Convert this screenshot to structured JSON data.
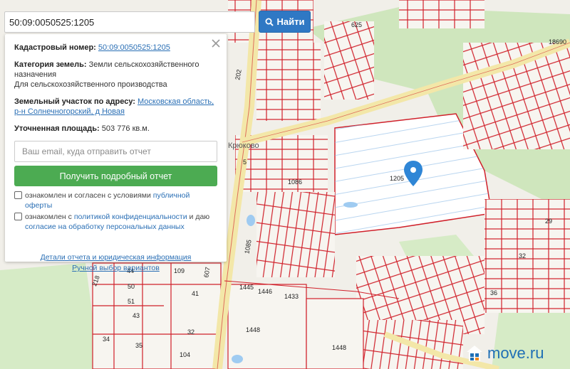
{
  "search": {
    "value": "50:09:0050525:1205",
    "button_label": "Найти"
  },
  "panel": {
    "cadastral_label": "Кадастровый номер:",
    "cadastral_value": "50:09:0050525:1205",
    "category_label": "Категория земель:",
    "category_value": "Земли сельскохозяйственного назначения",
    "category_use": "Для сельскохозяйственного производства",
    "address_label": "Земельный участок по адресу:",
    "address_value": "Московская область, р-н Солнечногорский, д Новая",
    "area_label": "Уточненная площадь:",
    "area_value": "503 776 кв.м.",
    "email_placeholder": "Ваш email, куда отправить отчет",
    "report_button": "Получить подробный отчет",
    "consent1_text": "ознакомлен и согласен с условиями",
    "consent1_link": "публичной оферты",
    "consent2_text": "ознакомлен с",
    "consent2_link": "политикой конфиденциальности",
    "consent2_text2": "и даю",
    "consent2_link2": "согласие на обработку персональных данных",
    "details_link": "Детали отчета и юридическая информация",
    "manual_link": "Ручной выбор вариантов"
  },
  "map": {
    "labels": {
      "p1205": "1205",
      "p1086": "1086",
      "p1085": "1085",
      "p1445": "1445",
      "p1446": "1446",
      "p1433": "1433",
      "p1448a": "1448",
      "p1448b": "1448",
      "p625": "625",
      "p18690": "18690",
      "p202": "202",
      "p44": "44",
      "p109": "109",
      "p607": "607",
      "p218": "218",
      "p50": "50",
      "p41": "41",
      "p51": "51",
      "p43": "43",
      "p32a": "32",
      "p34": "34",
      "p35": "35",
      "p104": "104",
      "p29": "29",
      "p32b": "32",
      "p36": "36",
      "p5": "5",
      "village": "Крюково"
    }
  },
  "logo": {
    "text": "move.ru"
  },
  "colors": {
    "parcel_line": "#d0202a",
    "road": "#f3e7a8",
    "forest": "#cfe6bd",
    "button_blue": "#2f78c4",
    "button_green": "#4cab52"
  }
}
